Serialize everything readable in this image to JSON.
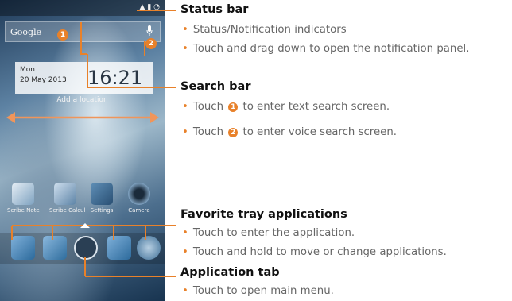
{
  "phone": {
    "search_label": "Google",
    "date_line1": "Mon",
    "date_line2": "20 May 2013",
    "time": "16:21",
    "add_location": "Add a location",
    "apps": [
      {
        "label": "Scribe Note"
      },
      {
        "label": "Scribe Calcul"
      },
      {
        "label": "Settings"
      },
      {
        "label": "Camera"
      }
    ],
    "marker1": "1",
    "marker2": "2"
  },
  "callouts": {
    "status_bar": {
      "heading": "Status bar",
      "bullets": [
        "Status/Notification indicators",
        "Touch and drag down to open the notification panel."
      ]
    },
    "search_bar": {
      "heading": "Search bar",
      "bullet1_pre": "Touch",
      "bullet1_num": "1",
      "bullet1_post": "to enter text search screen.",
      "bullet2_pre": "Touch",
      "bullet2_num": "2",
      "bullet2_post": "to enter voice search screen."
    },
    "favorite_tray": {
      "heading": "Favorite tray applications",
      "bullets": [
        "Touch to enter the application.",
        "Touch and hold to move or change applications."
      ]
    },
    "application_tab": {
      "heading": "Application tab",
      "bullets": [
        "Touch to open main menu."
      ]
    }
  },
  "colors": {
    "accent": "#e8812a",
    "heading": "#111111",
    "body_text": "#666666"
  }
}
